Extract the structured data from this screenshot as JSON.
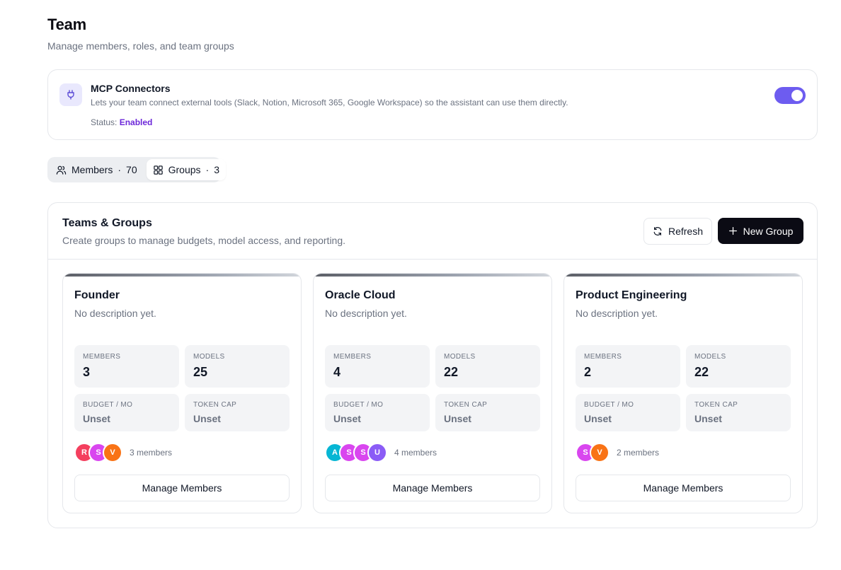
{
  "header": {
    "title": "Team",
    "subtitle": "Manage members, roles, and team groups"
  },
  "connector": {
    "icon": "plug-icon",
    "title": "MCP Connectors",
    "description": "Lets your team connect external tools (Slack, Notion, Microsoft 365, Google Workspace) so the assistant can use them directly.",
    "status_label": "Status:",
    "status_value": "Enabled",
    "enabled": true,
    "accent_color": "#6d5cf0"
  },
  "tabs": [
    {
      "icon": "users-icon",
      "label": "Members",
      "count": "70",
      "active": false
    },
    {
      "icon": "grid-icon",
      "label": "Groups",
      "count": "3",
      "active": true
    }
  ],
  "panel": {
    "title": "Teams & Groups",
    "description": "Create groups to manage budgets, model access, and reporting.",
    "refresh_label": "Refresh",
    "new_group_label": "New Group"
  },
  "stat_labels": {
    "members": "MEMBERS",
    "models": "MODELS",
    "budget": "BUDGET / MO",
    "token_cap": "TOKEN CAP"
  },
  "groups": [
    {
      "name": "Founder",
      "description": "No description yet.",
      "members": "3",
      "models": "25",
      "budget": "Unset",
      "token_cap": "Unset",
      "avatars": [
        {
          "initial": "R",
          "color": "#f43f5e"
        },
        {
          "initial": "S",
          "color": "#d946ef"
        },
        {
          "initial": "V",
          "color": "#f97316"
        }
      ],
      "members_text": "3 members",
      "manage_label": "Manage Members"
    },
    {
      "name": "Oracle Cloud",
      "description": "No description yet.",
      "members": "4",
      "models": "22",
      "budget": "Unset",
      "token_cap": "Unset",
      "avatars": [
        {
          "initial": "A",
          "color": "#06b6d4"
        },
        {
          "initial": "S",
          "color": "#d946ef"
        },
        {
          "initial": "S",
          "color": "#d946ef"
        },
        {
          "initial": "U",
          "color": "#8b5cf6"
        }
      ],
      "members_text": "4 members",
      "manage_label": "Manage Members"
    },
    {
      "name": "Product Engineering",
      "description": "No description yet.",
      "members": "2",
      "models": "22",
      "budget": "Unset",
      "token_cap": "Unset",
      "avatars": [
        {
          "initial": "S",
          "color": "#d946ef"
        },
        {
          "initial": "V",
          "color": "#f97316"
        }
      ],
      "members_text": "2 members",
      "manage_label": "Manage Members"
    }
  ]
}
